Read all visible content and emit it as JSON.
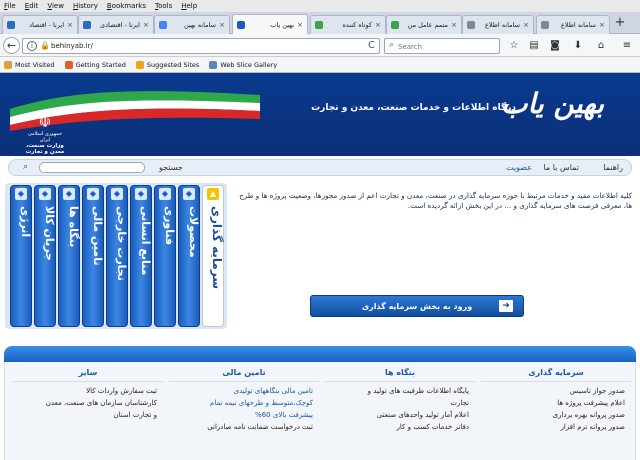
{
  "menubar": [
    "File",
    "Edit",
    "View",
    "History",
    "Bookmarks",
    "Tools",
    "Help"
  ],
  "tabs": [
    {
      "label": "بهین یاب",
      "color": "#1b5dbd",
      "active": true
    },
    {
      "label": "سامانه بهین",
      "color": "#4285f4",
      "active": false
    },
    {
      "label": "ایرنا - اقتصادی",
      "color": "#2a6cc0",
      "active": false
    },
    {
      "label": "ایرنا - اقتصاد",
      "color": "#2a6cc0",
      "active": false
    },
    {
      "label": "کوتاه کننده",
      "color": "#3aa44a",
      "active": false
    },
    {
      "label": "متمم عامل من",
      "color": "#3aa44a",
      "active": false
    },
    {
      "label": "سامانه اطلاع",
      "color": "#7a8899",
      "active": false
    },
    {
      "label": "سامانه اطلاع",
      "color": "#7a8899",
      "active": false
    }
  ],
  "tab_close": "×",
  "newtab": "+",
  "navbar": {
    "back": "←",
    "info": "i",
    "lock": "🔒",
    "url": "behinyab.ir/",
    "reload": "C",
    "search_placeholder": "Search",
    "icons": [
      "star-icon",
      "reader-icon",
      "pocket-icon",
      "download-icon",
      "home-icon",
      "menu-icon"
    ]
  },
  "bookmarks": [
    {
      "label": "Most Visited",
      "color": "#d9a23a"
    },
    {
      "label": "Getting Started",
      "color": "#e0602a"
    },
    {
      "label": "Suggested Sites",
      "color": "#f0a21a"
    },
    {
      "label": "Web Slice Gallery",
      "color": "#5a86c4"
    }
  ],
  "header": {
    "logo": "بهین یاب",
    "slogan": "درگاه اطلاعات و خدمات صنعت، معدن و تجارت",
    "emblem_line1": "جمهوری اسلامی ایران",
    "emblem_line2": "وزارت صنعت، معدن و تجارت"
  },
  "mainnav": {
    "guide": "راهنما",
    "contact": "تماس با ما",
    "membership": "عضویت",
    "search_label": "جستجو"
  },
  "vtabs": [
    {
      "label": "سرمایه گذاری",
      "active": true
    },
    {
      "label": "محصولات",
      "active": false
    },
    {
      "label": "فناوری",
      "active": false
    },
    {
      "label": "منابع انسانی",
      "active": false
    },
    {
      "label": "تجارت خارجی",
      "active": false
    },
    {
      "label": "تامین مالی",
      "active": false
    },
    {
      "label": "بنگاه ها",
      "active": false
    },
    {
      "label": "جریان کالا",
      "active": false
    },
    {
      "label": "انرژی",
      "active": false
    }
  ],
  "info": {
    "description": "کلیه اطلاعات مفید و خدمات مرتبط با حوزه سرمایه گذاری در صنعت، معدن و تجارت اعم از صدور مجوزها، وضعیت پروژه ها و طرح ها، معرفی فرصت های سرمایه گذاری و ... در این بخش ارائه گردیده است.",
    "cta": "ورود به بخش سرمایه گذاری",
    "cta_arrow": "➜"
  },
  "footer": {
    "columns": [
      {
        "title": "سرمایه گذاری",
        "items": [
          {
            "text": "صدور جواز تاسیس",
            "blue": false
          },
          {
            "text": "اعلام پیشرفت پروژه ها",
            "blue": false
          },
          {
            "text": "صدور پروانه بهره برداری",
            "blue": false
          },
          {
            "text": "صدور پروانه ترم افزار",
            "blue": false
          }
        ]
      },
      {
        "title": "بنگاه ها",
        "items": [
          {
            "text": "پایگاه اطلاعات ظرفیت های تولید و",
            "blue": false
          },
          {
            "text": "تجارت",
            "blue": false
          },
          {
            "text": "اعلام آمار تولید واحدهای صنعتی",
            "blue": false
          },
          {
            "text": "دفاتر خدمات کسب و کار",
            "blue": false
          }
        ]
      },
      {
        "title": "تامین مالی",
        "items": [
          {
            "text": "تامین مالی بنگاههای تولیدی",
            "blue": true
          },
          {
            "text": "کوچک،متوسط و طرحهای نیمه تمام",
            "blue": true
          },
          {
            "text": "پیشرفت بالای 60%",
            "blue": true
          },
          {
            "text": "ثبت درخواست ضمانت نامه صادراتی",
            "blue": false
          }
        ]
      },
      {
        "title": "سایر",
        "items": [
          {
            "text": "ثبت سفارش واردات کالا",
            "blue": false
          },
          {
            "text": "کارشناسان سازمان های صنعت، معدن",
            "blue": false
          },
          {
            "text": "و تجارت استان",
            "blue": false
          }
        ]
      }
    ]
  }
}
